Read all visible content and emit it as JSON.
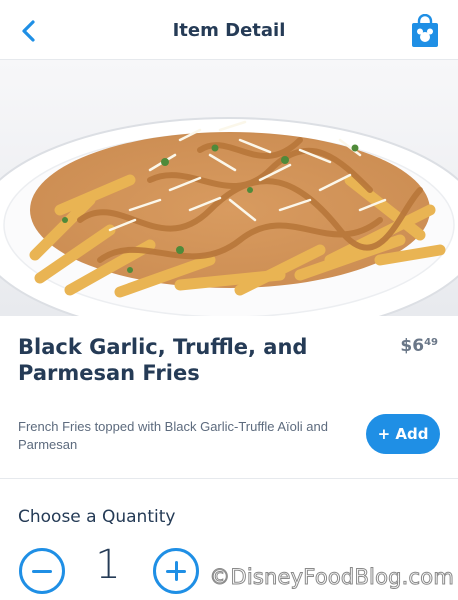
{
  "nav": {
    "title": "Item Detail",
    "back_icon": "chevron-left-icon",
    "bag_icon": "shopping-bag-mickey-icon"
  },
  "item": {
    "title": "Black Garlic, Truffle, and Parmesan Fries",
    "price_dollars": "$6",
    "price_cents": "49",
    "description": "French Fries topped with Black Garlic-Truffle Aïoli and Parmesan",
    "add_label": "+ Add"
  },
  "quantity": {
    "label": "Choose a Quantity",
    "value": "1"
  },
  "watermark": "©DisneyFoodBlog.com",
  "colors": {
    "accent": "#1f8fe5",
    "title": "#253b56",
    "muted": "#5d6b7e"
  }
}
